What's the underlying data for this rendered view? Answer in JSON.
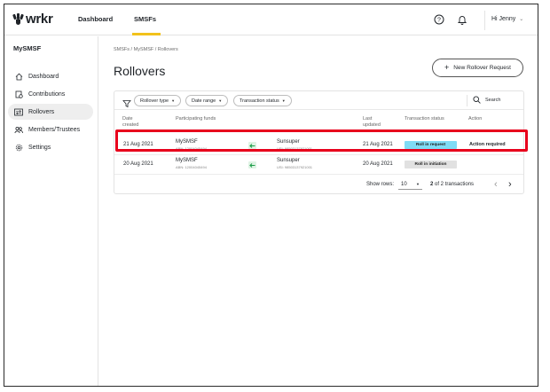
{
  "app": {
    "logo_text": "wrkr"
  },
  "topnav": {
    "items": [
      {
        "label": "Dashboard"
      },
      {
        "label": "SMSFs"
      }
    ],
    "user_label": "Hi Jenny"
  },
  "sidebar": {
    "title": "MySMSF",
    "items": [
      {
        "label": "Dashboard",
        "icon": "home-icon"
      },
      {
        "label": "Contributions",
        "icon": "contributions-icon"
      },
      {
        "label": "Rollovers",
        "icon": "rollovers-icon",
        "active": true
      },
      {
        "label": "Members/Trustees",
        "icon": "members-icon"
      },
      {
        "label": "Settings",
        "icon": "gear-icon"
      }
    ]
  },
  "main": {
    "breadcrumb": "SMSFs / MySMSF / Rollovers",
    "title": "Rollovers",
    "new_button": "New Rollover Request"
  },
  "filters": {
    "chips": [
      "Rollover type",
      "Date range",
      "Transaction status"
    ],
    "search_label": "Search"
  },
  "table": {
    "headers": {
      "date_created": [
        "Date",
        "created"
      ],
      "participating_funds": "Participating funds",
      "last_updated": [
        "Last",
        "updated"
      ],
      "transaction_status": "Transaction status",
      "action": "Action"
    },
    "rows": [
      {
        "date_created": "21 Aug 2021",
        "from_fund": "MySMSF",
        "from_id": "ABN: 12004045494",
        "to_fund": "Sunsuper",
        "to_id": "USI: 98503137921001",
        "last_updated": "21 Aug 2021",
        "status": "Roll in request",
        "status_color": "#7fdcf5",
        "action": "Action required"
      },
      {
        "date_created": "20 Aug 2021",
        "from_fund": "MySMSF",
        "from_id": "ABN: 12004045494",
        "to_fund": "Sunsuper",
        "to_id": "USI: 98503137921001",
        "last_updated": "20 Aug 2021",
        "status": "Roll in initiation",
        "status_color": "#e1e1e1",
        "action": ""
      }
    ]
  },
  "pagination": {
    "show_rows_label": "Show rows:",
    "rows_value": "10",
    "range_current": "2",
    "range_text": "of 2 transactions"
  },
  "colors": {
    "accent": "#f2c21b",
    "highlight": "#e8001c",
    "arrow_green": "#1e9e4a"
  }
}
